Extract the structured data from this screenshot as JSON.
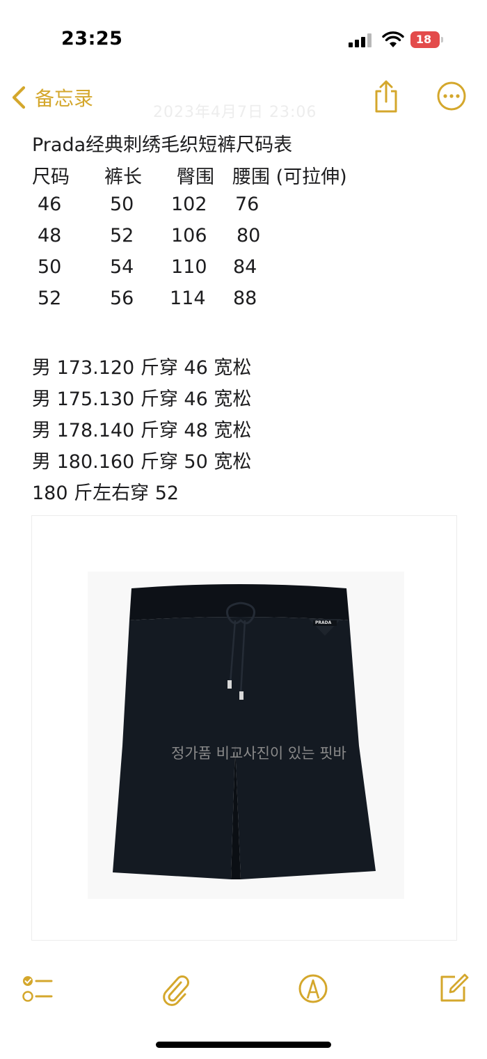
{
  "status_bar": {
    "time": "23:25",
    "battery": "18"
  },
  "nav": {
    "back_label": "备忘录",
    "faded_date": "2023年4月7日 23:06"
  },
  "note": {
    "title": "Prada经典刺绣毛织短裤尺码表",
    "headers": [
      "尺码",
      "裤长",
      "臀围",
      "腰围 (可拉伸)"
    ],
    "rows": [
      [
        "46",
        "50",
        "102",
        "76"
      ],
      [
        "48",
        "52",
        "106",
        "80"
      ],
      [
        "50",
        "54",
        "110",
        "84"
      ],
      [
        "52",
        "56",
        "114",
        "88"
      ]
    ],
    "lines": [
      "男 173.120 斤穿 46 宽松",
      "男 175.130 斤穿 46 宽松",
      "男 178.140 斤穿 48 宽松",
      "男 180.160 斤穿 50 宽松",
      "180 斤左右穿 52"
    ]
  },
  "image": {
    "watermark": "정가품 비교사진이 있는 핏바",
    "logo_text": "PRADA"
  },
  "colors": {
    "accent": "#d4a72c",
    "battery": "#e34b4b",
    "text": "#1c1c1e"
  },
  "icons": [
    "chevron-left-icon",
    "share-icon",
    "more-icon",
    "checklist-icon",
    "paperclip-icon",
    "markup-icon",
    "compose-icon"
  ]
}
